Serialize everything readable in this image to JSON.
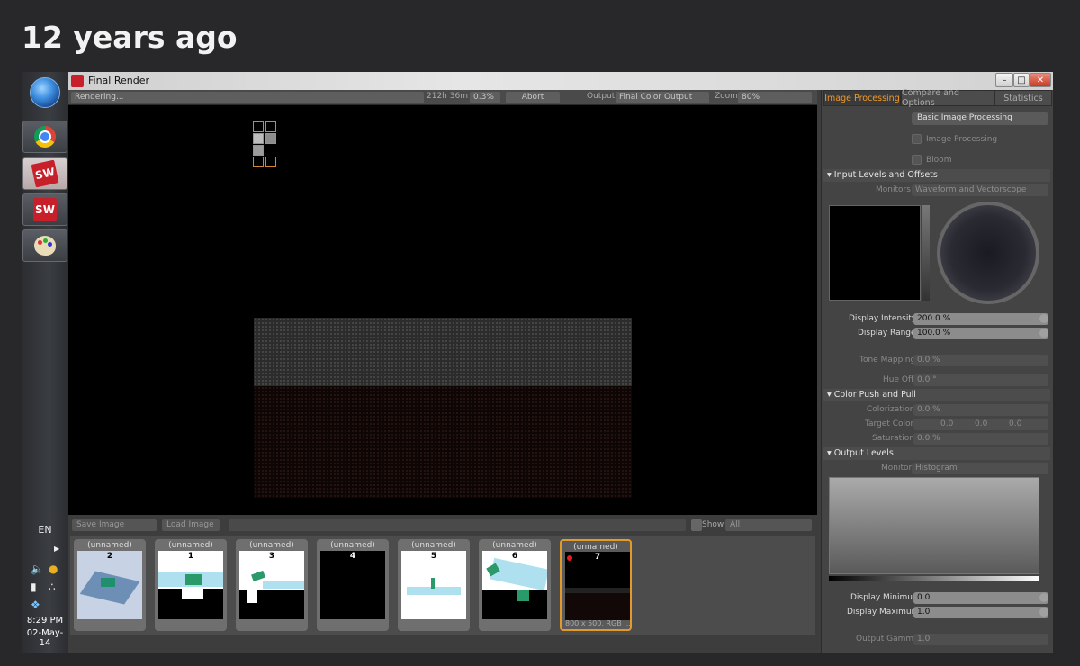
{
  "page": {
    "title": "12 years ago"
  },
  "window": {
    "title": "Final Render"
  },
  "taskbar": {
    "apps": [
      {
        "name": "start",
        "icon": "windows-start-icon"
      },
      {
        "name": "chrome",
        "icon": "chrome-icon"
      },
      {
        "name": "solidworks-1",
        "icon": "solidworks-icon",
        "label": "SW"
      },
      {
        "name": "solidworks-2",
        "icon": "solidworks-icon",
        "label": "SW"
      },
      {
        "name": "paint",
        "icon": "paint-palette-icon"
      }
    ],
    "tray": {
      "language": "EN",
      "time": "8:29 PM",
      "date": "02-May-14"
    }
  },
  "toolbar": {
    "status": "Rendering...",
    "elapsed": "212h 36m",
    "percent": "0.3%",
    "abort_label": "Abort",
    "output_label": "Output",
    "output_value": "Final Color Output",
    "zoom_label": "Zoom",
    "zoom_value": "80%"
  },
  "bottombar": {
    "save_label": "Save Image",
    "load_label": "Load Image",
    "show_label": "Show",
    "show_value": "All"
  },
  "thumbnails": [
    {
      "name": "(unnamed)",
      "number": "2"
    },
    {
      "name": "(unnamed)",
      "number": "1"
    },
    {
      "name": "(unnamed)",
      "number": "3"
    },
    {
      "name": "(unnamed)",
      "number": "4"
    },
    {
      "name": "(unnamed)",
      "number": "5"
    },
    {
      "name": "(unnamed)",
      "number": "6"
    },
    {
      "name": "(unnamed)",
      "number": "7",
      "caption": "800 x 500, RGB ..."
    }
  ],
  "panel": {
    "tabs": [
      "Image Processing",
      "Compare and Options",
      "Statistics"
    ],
    "basic_button": "Basic Image Processing",
    "checks": {
      "image_processing": "Image Processing",
      "bloom": "Bloom"
    },
    "input_section": "Input Levels and Offsets",
    "monitors_label": "Monitors",
    "monitors_value": "Waveform and Vectorscope",
    "display_intensity_label": "Display Intensity",
    "display_intensity_value": "200.0 %",
    "display_range_label": "Display Range",
    "display_range_value": "100.0 %",
    "tone_mapping_label": "Tone Mapping",
    "tone_mapping_value": "0.0 %",
    "hue_offset_label": "Hue Offset",
    "hue_offset_value": "0.0 °",
    "color_section": "Color Push and Pull",
    "colorization_label": "Colorization",
    "colorization_value": "0.0 %",
    "target_color_label": "Target Color",
    "target_color_r": "0.0",
    "target_color_g": "0.0",
    "target_color_b": "0.0",
    "saturation_label": "Saturation",
    "saturation_value": "0.0 %",
    "output_section": "Output Levels",
    "monitor_label": "Monitor",
    "monitor_value": "Histogram",
    "display_minimum_label": "Display Minimum",
    "display_minimum_value": "0.0",
    "display_maximum_label": "Display Maximum",
    "display_maximum_value": "1.0",
    "output_gamma_label": "Output Gamma",
    "output_gamma_value": "1.0"
  },
  "colors": {
    "accent": "#e39a2d",
    "tab_active": "#f09a2d",
    "tile_border": "#d5862a"
  }
}
